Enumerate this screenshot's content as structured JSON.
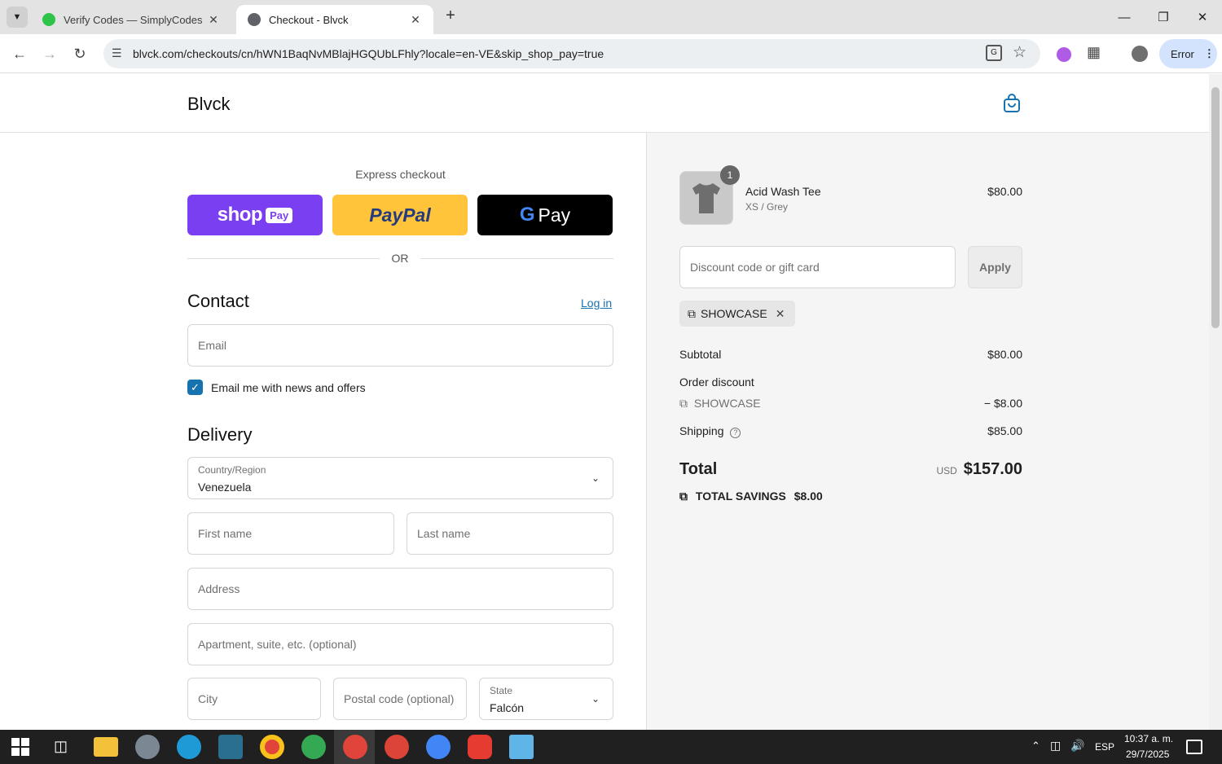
{
  "browser": {
    "tabs": [
      {
        "title": "Verify Codes — SimplyCodes"
      },
      {
        "title": "Checkout - Blvck"
      }
    ],
    "url": "blvck.com/checkouts/cn/hWN1BaqNvMBlajHGQUbLFhly?locale=en-VE&skip_shop_pay=true",
    "profile_button": "Error"
  },
  "header": {
    "logo": "Blvck"
  },
  "express": {
    "label": "Express checkout",
    "shop_pay": "shop",
    "shop_pay_badge": "Pay",
    "paypal": "PayPal",
    "gpay": "Pay",
    "divider": "OR"
  },
  "contact": {
    "title": "Contact",
    "login": "Log in",
    "email_placeholder": "Email",
    "newsletter": "Email me with news and offers"
  },
  "delivery": {
    "title": "Delivery",
    "country_label": "Country/Region",
    "country_value": "Venezuela",
    "first_name": "First name",
    "last_name": "Last name",
    "address": "Address",
    "apartment": "Apartment, suite, etc. (optional)",
    "city": "City",
    "postal": "Postal code (optional)",
    "state_label": "State",
    "state_value": "Falcón"
  },
  "summary": {
    "item": {
      "qty": "1",
      "name": "Acid Wash Tee",
      "variant": "XS / Grey",
      "price": "$80.00"
    },
    "discount_placeholder": "Discount code or gift card",
    "apply": "Apply",
    "code_chip": "SHOWCASE",
    "subtotal_label": "Subtotal",
    "subtotal": "$80.00",
    "order_discount_label": "Order discount",
    "discount_code": "SHOWCASE",
    "discount_amount": "− $8.00",
    "shipping_label": "Shipping",
    "shipping": "$85.00",
    "total_label": "Total",
    "currency": "USD",
    "total": "$157.00",
    "savings_label": "TOTAL SAVINGS",
    "savings": "$8.00"
  },
  "taskbar": {
    "lang": "ESP",
    "time": "10:37 a. m.",
    "date": "29/7/2025"
  },
  "colors": {
    "shop_pay": "#7b3ff2",
    "paypal": "#ffc439",
    "gpay": "#000000",
    "link": "#1773b0",
    "checkbox": "#1773b0"
  }
}
